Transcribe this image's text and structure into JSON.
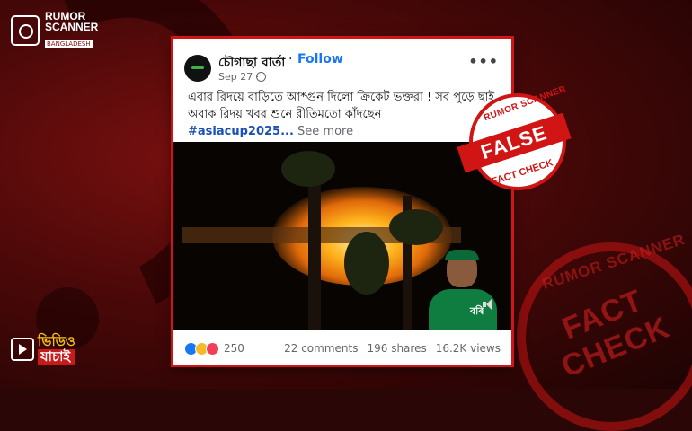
{
  "brand": {
    "logo_line1": "RUMOR",
    "logo_line2": "SCANNER",
    "logo_sub": "BANGLADESH",
    "video_line1": "ভিডিও",
    "video_line2": "যাচাই",
    "bg_stamp_top": "RUMOR SCANNER",
    "bg_stamp_main": "FACT CHECK"
  },
  "post": {
    "page_name": "চৌগাছা বার্তা",
    "separator": "·",
    "follow_label": "Follow",
    "date": "Sep 27 ·",
    "more_label": "•••",
    "text": "এবার রিদয়ে বাড়িতে আ*গুন দিলো ক্রিকেট ভক্তরা ! সব পুড়ে ছাই, অবাক রিদয় খবর শুনে রীতিমতো কাঁদছেন",
    "hashtag": "#asiacup2025...",
    "see_more": " See more",
    "jersey_text": "বৰি"
  },
  "stats": {
    "reactions_count": "250",
    "comments": "22 comments",
    "shares": "196 shares",
    "views": "16.2K views"
  },
  "stamp": {
    "top": "RUMOR SCANNER",
    "verdict": "FALSE",
    "bottom": "FACT CHECK"
  },
  "colors": {
    "accent_red": "#d11414",
    "follow_blue": "#1877f2",
    "hashtag_blue": "#1a4fb5"
  }
}
